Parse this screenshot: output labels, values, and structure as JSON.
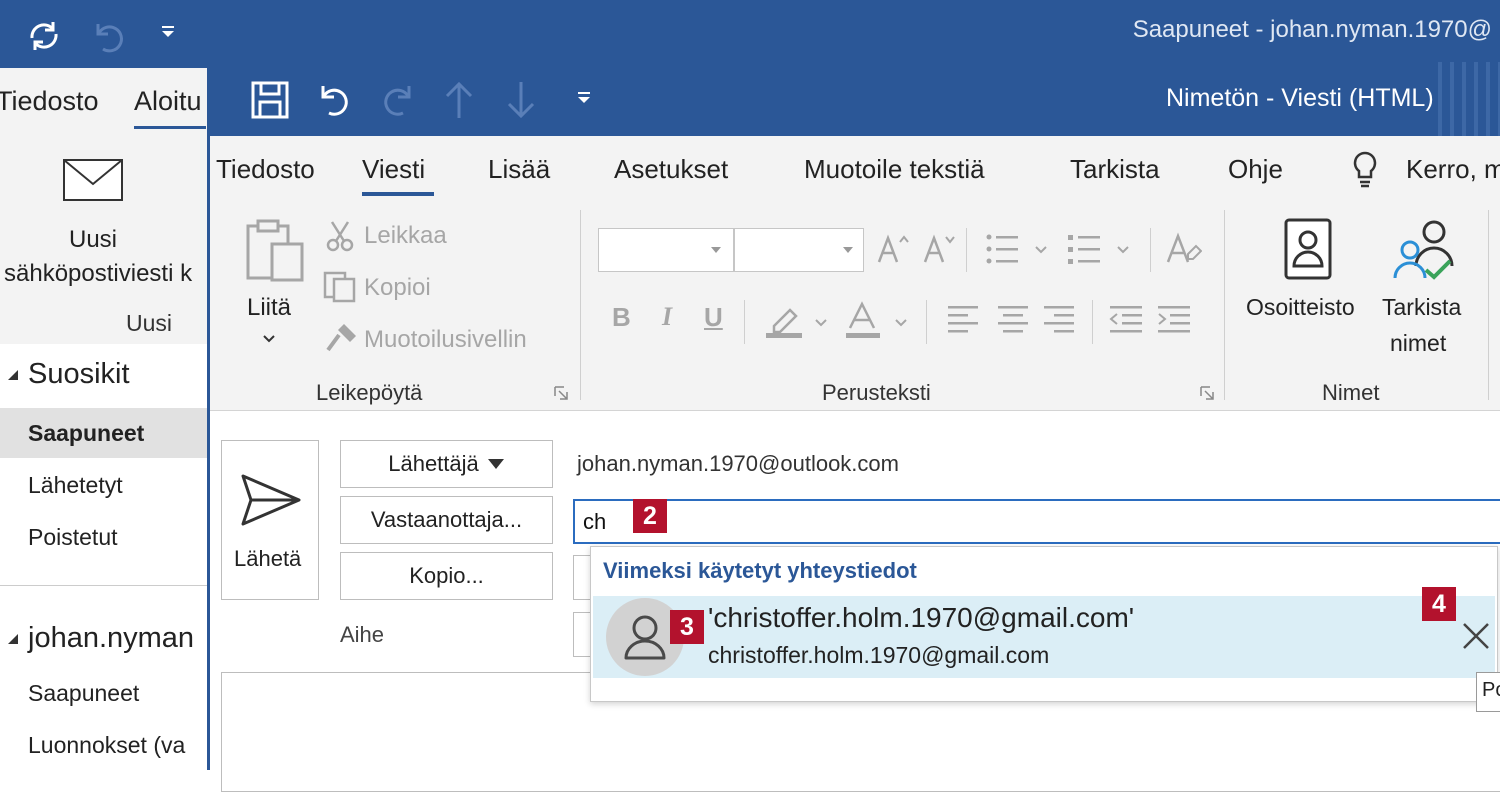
{
  "main_window": {
    "title": "Saapuneet - johan.nyman.1970@",
    "tabs": [
      "Tiedosto",
      "Aloitu"
    ],
    "new_mail": {
      "line1": "Uusi",
      "line2": "sähköpostiviesti k"
    },
    "group_label": "Uusi"
  },
  "nav": {
    "favorites_header": "Suosikit",
    "favorites": [
      "Saapuneet",
      "Lähetetyt",
      "Poistetut"
    ],
    "account_header": "johan.nyman",
    "account_items": [
      "Saapuneet",
      "Luonnokset (va"
    ]
  },
  "compose": {
    "title": "Nimetön  -  Viesti (HTML)",
    "tabs": [
      "Tiedosto",
      "Viesti",
      "Lisää",
      "Asetukset",
      "Muotoile tekstiä",
      "Tarkista",
      "Ohje",
      "Kerro, m"
    ],
    "clipboard": {
      "paste": "Liitä",
      "cut": "Leikkaa",
      "copy": "Kopioi",
      "format_painter": "Muotoilusivellin",
      "group_label": "Leikepöytä"
    },
    "basic_text": {
      "bold": "B",
      "italic": "I",
      "underline": "U",
      "group_label": "Perusteksti"
    },
    "names": {
      "address_book": "Osoitteisto",
      "check_names_line1": "Tarkista",
      "check_names_line2": "nimet",
      "group_label": "Nimet"
    },
    "send_label": "Lähetä",
    "from_button": "Lähettäjä",
    "from_address": "johan.nyman.1970@outlook.com",
    "to_button": "Vastaanottaja...",
    "to_value": "ch",
    "cc_button": "Kopio...",
    "subject_label": "Aihe"
  },
  "autocomplete": {
    "header": "Viimeksi käytetyt yhteystiedot",
    "item_name": "'christoffer.holm.1970@gmail.com'",
    "item_email": "christoffer.holm.1970@gmail.com",
    "tooltip": "Po"
  },
  "markers": [
    "2",
    "3",
    "4"
  ],
  "colors": {
    "titlebar": "#2b5797",
    "marker": "#b3122d",
    "highlight": "#dbeef6"
  }
}
